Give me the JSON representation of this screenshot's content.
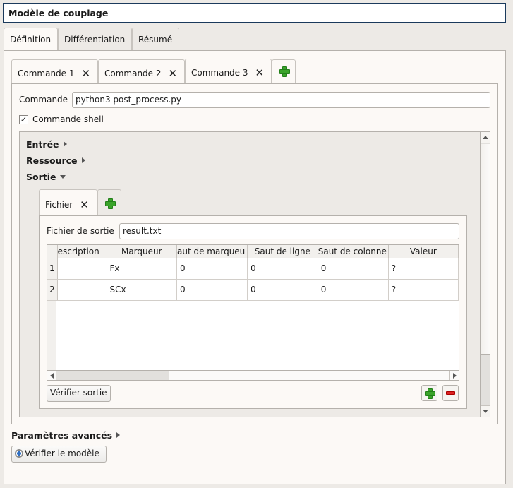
{
  "window": {
    "title": "Modèle de couplage"
  },
  "main_tabs": [
    {
      "label": "Définition",
      "active": true
    },
    {
      "label": "Différentiation",
      "active": false
    },
    {
      "label": "Résumé",
      "active": false
    }
  ],
  "command_tabs": [
    {
      "label": "Commande 1",
      "active": false
    },
    {
      "label": "Commande 2",
      "active": false
    },
    {
      "label": "Commande 3",
      "active": true
    }
  ],
  "command": {
    "label": "Commande",
    "value": "python3 post_process.py",
    "shell_label": "Commande shell",
    "shell_checked": true,
    "shell_check_glyph": "✓"
  },
  "sections": {
    "input": "Entrée",
    "resource": "Ressource",
    "output": "Sortie",
    "advanced": "Paramètres avancés"
  },
  "file_tabs": [
    {
      "label": "Fichier",
      "active": true
    }
  ],
  "output_file": {
    "label": "Fichier de sortie",
    "value": "result.txt"
  },
  "table": {
    "columns": [
      "escription",
      "Marqueur",
      "aut de marqueu",
      "Saut de ligne",
      "Saut de colonne",
      "Valeur"
    ],
    "rows": [
      {
        "num": "1",
        "cells": [
          "",
          "Fx",
          "0",
          "0",
          "0",
          "?"
        ]
      },
      {
        "num": "2",
        "cells": [
          "",
          "SCx",
          "0",
          "0",
          "0",
          "?"
        ]
      }
    ]
  },
  "buttons": {
    "check_output": "Vérifier sortie",
    "check_model": "Vérifier le modèle"
  },
  "icons": {
    "close": "✕",
    "add": "plus-icon",
    "remove": "minus-icon",
    "gear": "gear-icon"
  },
  "colors": {
    "accent": "#1b3a5c",
    "add_green": "#3aa32a",
    "remove_red": "#d22222"
  }
}
